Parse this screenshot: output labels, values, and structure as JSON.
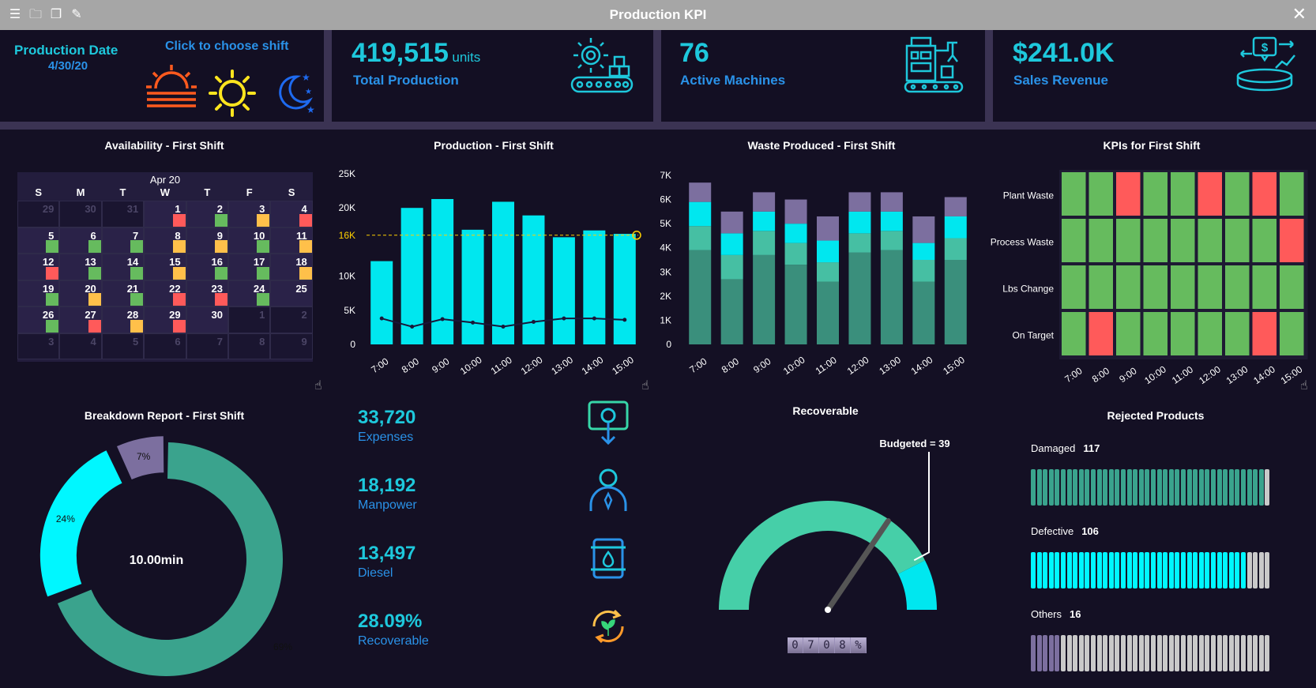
{
  "window": {
    "title": "Production KPI"
  },
  "header": {
    "production_date_label": "Production Date",
    "production_date": "4/30/20",
    "shift_prompt": "Click to choose shift",
    "total_production": {
      "value": "419,515",
      "unit": "units",
      "label": "Total Production"
    },
    "active_machines": {
      "value": "76",
      "label": "Active Machines"
    },
    "sales_revenue": {
      "value": "$241.0K",
      "label": "Sales Revenue"
    }
  },
  "availability": {
    "title": "Availability - First Shift",
    "month": "Apr 20",
    "weekdays": [
      "S",
      "M",
      "T",
      "W",
      "T",
      "F",
      "S"
    ],
    "weeks": [
      [
        [
          "29",
          "out",
          ""
        ],
        [
          "30",
          "out",
          ""
        ],
        [
          "31",
          "out",
          ""
        ],
        [
          "1",
          "in",
          "red"
        ],
        [
          "2",
          "in",
          "green"
        ],
        [
          "3",
          "in",
          "yellow"
        ],
        [
          "4",
          "in",
          "red"
        ]
      ],
      [
        [
          "5",
          "in",
          "green"
        ],
        [
          "6",
          "in",
          "green"
        ],
        [
          "7",
          "in",
          "green"
        ],
        [
          "8",
          "in",
          "yellow"
        ],
        [
          "9",
          "in",
          "yellow"
        ],
        [
          "10",
          "in",
          "green"
        ],
        [
          "11",
          "in",
          "yellow"
        ]
      ],
      [
        [
          "12",
          "in",
          "red"
        ],
        [
          "13",
          "in",
          "green"
        ],
        [
          "14",
          "in",
          "green"
        ],
        [
          "15",
          "in",
          "yellow"
        ],
        [
          "16",
          "in",
          "green"
        ],
        [
          "17",
          "in",
          "green"
        ],
        [
          "18",
          "in",
          "yellow"
        ]
      ],
      [
        [
          "19",
          "in",
          "green"
        ],
        [
          "20",
          "in",
          "yellow"
        ],
        [
          "21",
          "in",
          "green"
        ],
        [
          "22",
          "in",
          "red"
        ],
        [
          "23",
          "in",
          "red"
        ],
        [
          "24",
          "in",
          "green"
        ],
        [
          "25",
          "in",
          ""
        ]
      ],
      [
        [
          "26",
          "in",
          "green"
        ],
        [
          "27",
          "in",
          "red"
        ],
        [
          "28",
          "in",
          "yellow"
        ],
        [
          "29",
          "in",
          "red"
        ],
        [
          "30",
          "in",
          ""
        ],
        [
          "1",
          "out",
          ""
        ],
        [
          "2",
          "out",
          ""
        ]
      ],
      [
        [
          "3",
          "out",
          ""
        ],
        [
          "4",
          "out",
          ""
        ],
        [
          "5",
          "out",
          ""
        ],
        [
          "6",
          "out",
          ""
        ],
        [
          "7",
          "out",
          ""
        ],
        [
          "8",
          "out",
          ""
        ],
        [
          "9",
          "out",
          ""
        ]
      ]
    ]
  },
  "chart_data": [
    {
      "type": "bar",
      "title": "Production - First Shift",
      "categories": [
        "7:00",
        "8:00",
        "9:00",
        "10:00",
        "11:00",
        "12:00",
        "13:00",
        "14:00",
        "15:00"
      ],
      "series": [
        {
          "name": "Production",
          "values": [
            12200,
            20000,
            21300,
            16800,
            20900,
            18900,
            15700,
            16700,
            16200
          ]
        },
        {
          "name": "Line",
          "values": [
            3800,
            2600,
            3700,
            3200,
            2600,
            3300,
            3800,
            3800,
            3600
          ]
        }
      ],
      "target": {
        "label": "16K",
        "value": 16000
      },
      "yticks": [
        "0",
        "5K",
        "10K",
        "16K",
        "20K",
        "25K"
      ],
      "ytick_values": [
        0,
        5000,
        10000,
        16000,
        20000,
        25000
      ],
      "ylim": [
        0,
        25000
      ]
    },
    {
      "type": "bar",
      "stacked": true,
      "title": "Waste Produced - First Shift",
      "categories": [
        "7:00",
        "8:00",
        "9:00",
        "10:00",
        "11:00",
        "12:00",
        "13:00",
        "14:00",
        "15:00"
      ],
      "series": [
        {
          "values": [
            3900,
            2700,
            3700,
            3300,
            2600,
            3800,
            3900,
            2600,
            3500
          ]
        },
        {
          "values": [
            1000,
            1000,
            1000,
            900,
            800,
            800,
            800,
            900,
            900
          ]
        },
        {
          "values": [
            1000,
            900,
            800,
            800,
            900,
            900,
            800,
            700,
            900
          ]
        },
        {
          "values": [
            800,
            900,
            800,
            1000,
            1000,
            800,
            800,
            1100,
            800
          ]
        }
      ],
      "yticks": [
        "0",
        "1K",
        "2K",
        "3K",
        "4K",
        "5K",
        "6K",
        "7K"
      ],
      "ylim": [
        0,
        7000
      ]
    },
    {
      "type": "heatmap",
      "title": "KPIs for First Shift",
      "rows": [
        "Plant Waste",
        "Process Waste",
        "Lbs Change",
        "On Target"
      ],
      "columns": [
        "7:00",
        "8:00",
        "9:00",
        "10:00",
        "11:00",
        "12:00",
        "13:00",
        "14:00",
        "15:00"
      ],
      "values": [
        [
          "green",
          "green",
          "red",
          "green",
          "green",
          "red",
          "green",
          "red",
          "green"
        ],
        [
          "green",
          "green",
          "green",
          "green",
          "green",
          "green",
          "green",
          "green",
          "red"
        ],
        [
          "green",
          "green",
          "green",
          "green",
          "green",
          "green",
          "green",
          "green",
          "green"
        ],
        [
          "green",
          "red",
          "green",
          "green",
          "green",
          "green",
          "green",
          "red",
          "green"
        ]
      ]
    },
    {
      "type": "pie",
      "title": "Breakdown Report - First Shift",
      "center_label": "10.00min",
      "slices": [
        {
          "label": "69%",
          "value": 69,
          "color": "#3aa38d"
        },
        {
          "label": "24%",
          "value": 24,
          "color": "#00f7ff"
        },
        {
          "label": "7%",
          "value": 7,
          "color": "#7c6f9f"
        }
      ]
    }
  ],
  "expenses": [
    {
      "value": "33,720",
      "label": "Expenses",
      "icon": "money-down-icon"
    },
    {
      "value": "18,192",
      "label": "Manpower",
      "icon": "person-icon"
    },
    {
      "value": "13,497",
      "label": "Diesel",
      "icon": "barrel-icon"
    },
    {
      "value": "28.09%",
      "label": "Recoverable",
      "icon": "recycle-icon"
    }
  ],
  "recoverable": {
    "title": "Recoverable",
    "budgeted_label": "Budgeted = 39",
    "counter": [
      "0",
      "7",
      "0",
      "8",
      "%"
    ],
    "gauge_fraction": 0.69
  },
  "rejected": {
    "title": "Rejected Products",
    "items": [
      {
        "label": "Damaged",
        "value": "117",
        "filled": 39,
        "total": 40,
        "color": "#3aa38d"
      },
      {
        "label": "Defective",
        "value": "106",
        "filled": 36,
        "total": 40,
        "color": "#00f7ff"
      },
      {
        "label": "Others",
        "value": "16",
        "filled": 5,
        "total": 40,
        "color": "#7c6f9f"
      }
    ]
  },
  "colors": {
    "accent": "#1ec8dc",
    "label_blue": "#2a92e8",
    "cyan": "#00e7ef",
    "teal_dark": "#3a8f7c",
    "teal_mid": "#46bfa3",
    "purple": "#7c6f9f",
    "red": "#ff5a5a",
    "green": "#66bb5e",
    "yellow": "#ffc04a"
  }
}
